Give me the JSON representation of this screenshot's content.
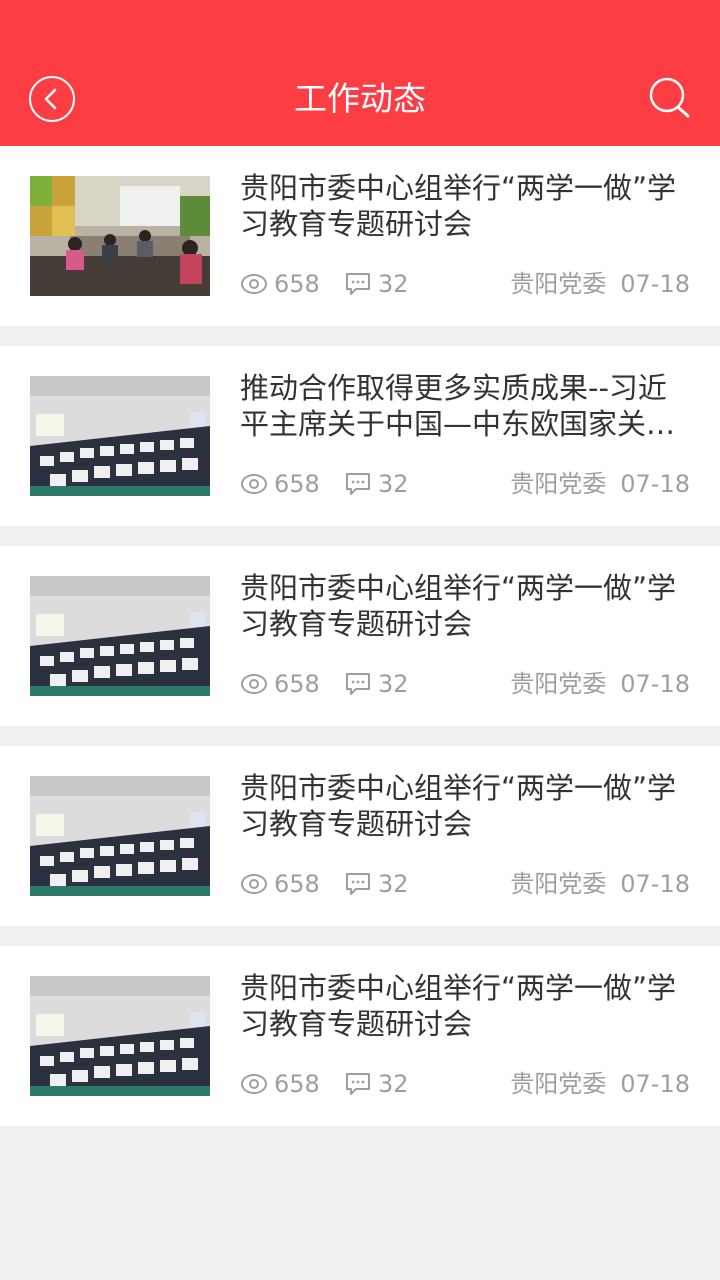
{
  "header": {
    "title": "工作动态",
    "back_icon": "back-circle-icon",
    "search_icon": "search-icon",
    "bg_color": "#fd3d44"
  },
  "articles": [
    {
      "title": "贵阳市委中心组举行“两学一做”学习教育专题研讨会",
      "views": "658",
      "comments": "32",
      "source": "贵阳党委",
      "date": "07-18",
      "image": "meeting-room-photo"
    },
    {
      "title": "推动合作取得更多实质成果--习近平主席关于中国—中东欧国家关系的论述",
      "views": "658",
      "comments": "32",
      "source": "贵阳党委",
      "date": "07-18",
      "image": "auditorium-photo"
    },
    {
      "title": "贵阳市委中心组举行“两学一做”学习教育专题研讨会",
      "views": "658",
      "comments": "32",
      "source": "贵阳党委",
      "date": "07-18",
      "image": "auditorium-photo"
    },
    {
      "title": "贵阳市委中心组举行“两学一做”学习教育专题研讨会",
      "views": "658",
      "comments": "32",
      "source": "贵阳党委",
      "date": "07-18",
      "image": "auditorium-photo"
    },
    {
      "title": "贵阳市委中心组举行“两学一做”学习教育专题研讨会",
      "views": "658",
      "comments": "32",
      "source": "贵阳党委",
      "date": "07-18",
      "image": "auditorium-photo"
    }
  ]
}
